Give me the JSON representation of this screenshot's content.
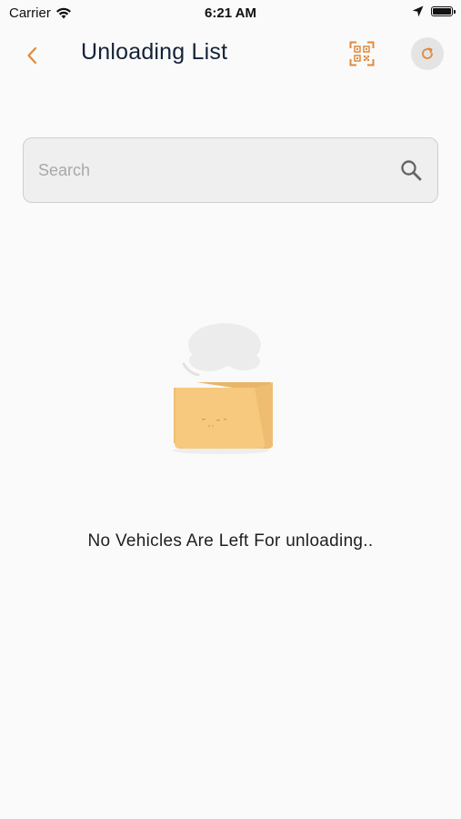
{
  "status_bar": {
    "carrier": "Carrier",
    "time": "6:21 AM",
    "icons": [
      "wifi-icon",
      "location-arrow-icon",
      "battery-icon"
    ]
  },
  "header": {
    "title": "Unloading List",
    "back_icon": "chevron-left-icon",
    "qr_icon": "qr-scan-icon",
    "refresh_icon": "refresh-icon"
  },
  "search": {
    "placeholder": "Search",
    "value": "",
    "icon": "search-icon"
  },
  "empty_state": {
    "illustration": "empty-box-illustration",
    "message": "No Vehicles Are Left For unloading.."
  },
  "colors": {
    "accent": "#e08a3c",
    "title": "#152238",
    "background": "#fafafa",
    "box_fill": "#f6c97f",
    "box_shade": "#e9b56a",
    "refresh_bg": "#e4e4e4"
  }
}
